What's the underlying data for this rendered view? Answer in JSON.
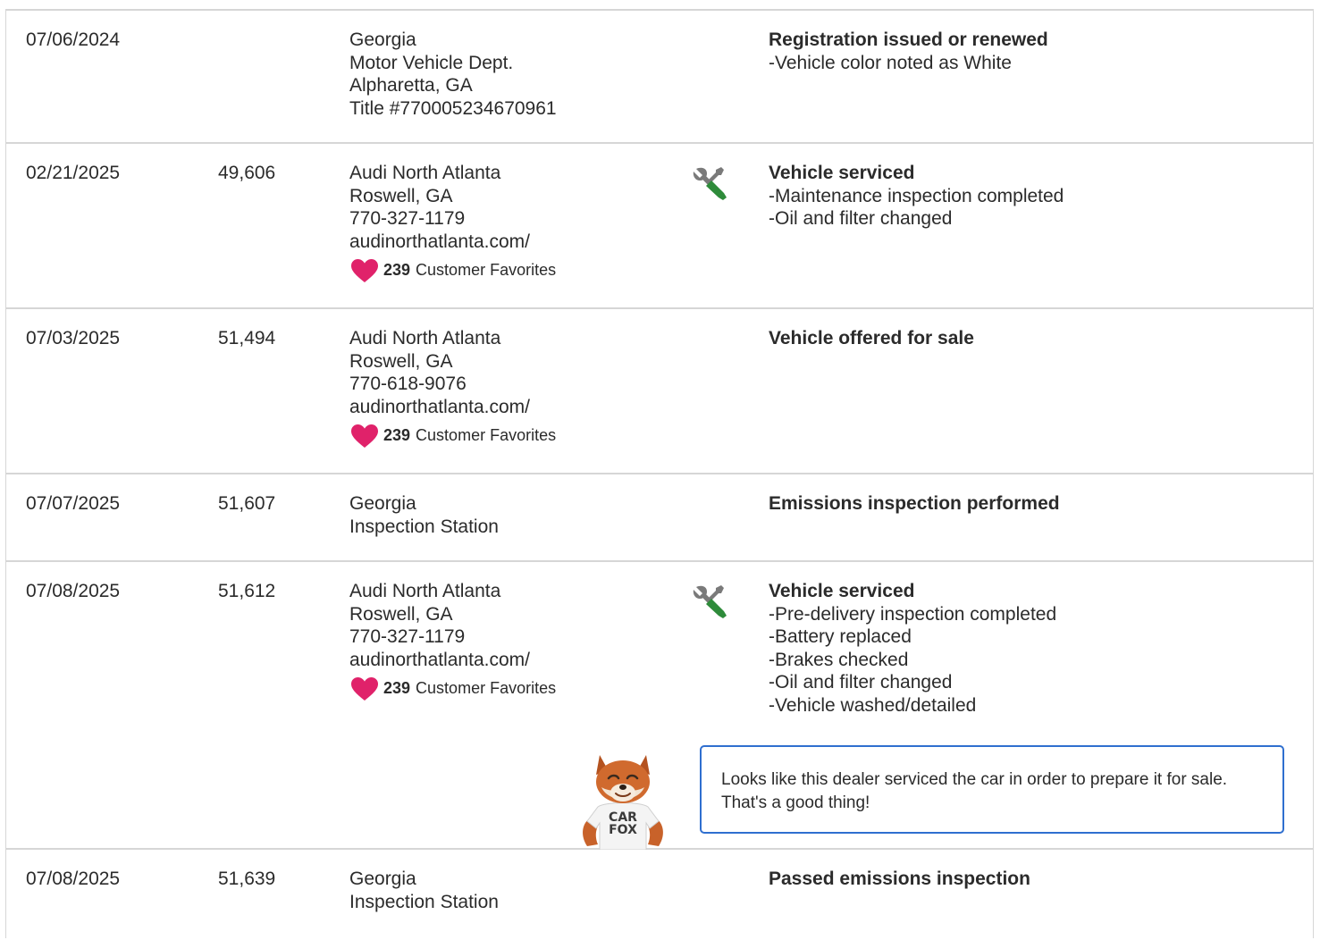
{
  "records": [
    {
      "date": "07/06/2024",
      "odometer": "",
      "source": [
        "Georgia",
        "Motor Vehicle Dept.",
        "Alpharetta, GA",
        "Title #770005234670961"
      ],
      "favorites": null,
      "icon": null,
      "title": "Registration issued or renewed",
      "details": [
        "-Vehicle color noted as White"
      ]
    },
    {
      "date": "02/21/2025",
      "odometer": "49,606",
      "source": [
        "Audi North Atlanta",
        "Roswell, GA",
        "770-327-1179",
        "audinorthatlanta.com/"
      ],
      "favorites": {
        "count": "239",
        "label": "Customer Favorites"
      },
      "icon": "service-wrench-screwdriver-icon",
      "title": "Vehicle serviced",
      "details": [
        "-Maintenance inspection completed",
        "-Oil and filter changed"
      ]
    },
    {
      "date": "07/03/2025",
      "odometer": "51,494",
      "source": [
        "Audi North Atlanta",
        "Roswell, GA",
        "770-618-9076",
        "audinorthatlanta.com/"
      ],
      "favorites": {
        "count": "239",
        "label": "Customer Favorites"
      },
      "icon": null,
      "title": "Vehicle offered for sale",
      "details": []
    },
    {
      "date": "07/07/2025",
      "odometer": "51,607",
      "source": [
        "Georgia",
        "Inspection Station"
      ],
      "favorites": null,
      "icon": null,
      "title": "Emissions inspection performed",
      "details": []
    },
    {
      "date": "07/08/2025",
      "odometer": "51,612",
      "source": [
        "Audi North Atlanta",
        "Roswell, GA",
        "770-327-1179",
        "audinorthatlanta.com/"
      ],
      "favorites": {
        "count": "239",
        "label": "Customer Favorites"
      },
      "icon": "service-wrench-screwdriver-icon",
      "title": "Vehicle serviced",
      "details": [
        "-Pre-delivery inspection completed",
        "-Battery replaced",
        "-Brakes checked",
        "-Oil and filter changed",
        "-Vehicle washed/detailed"
      ],
      "callout": {
        "text_line1": "Looks like this dealer serviced the car in order to prepare it for sale.",
        "text_line2": "That's a good thing!",
        "mascot_shirt_line1": "CAR",
        "mascot_shirt_line2": "FOX"
      }
    },
    {
      "date": "07/08/2025",
      "odometer": "51,639",
      "source": [
        "Georgia",
        "Inspection Station"
      ],
      "favorites": null,
      "icon": null,
      "title": "Passed emissions inspection",
      "details": []
    }
  ],
  "colors": {
    "heart": "#e0226a",
    "wrench_grey": "#7a7a7a",
    "screwdriver_green": "#2e8b3a",
    "callout_border": "#2f6fcf",
    "row_divider": "#d6d6d6"
  }
}
